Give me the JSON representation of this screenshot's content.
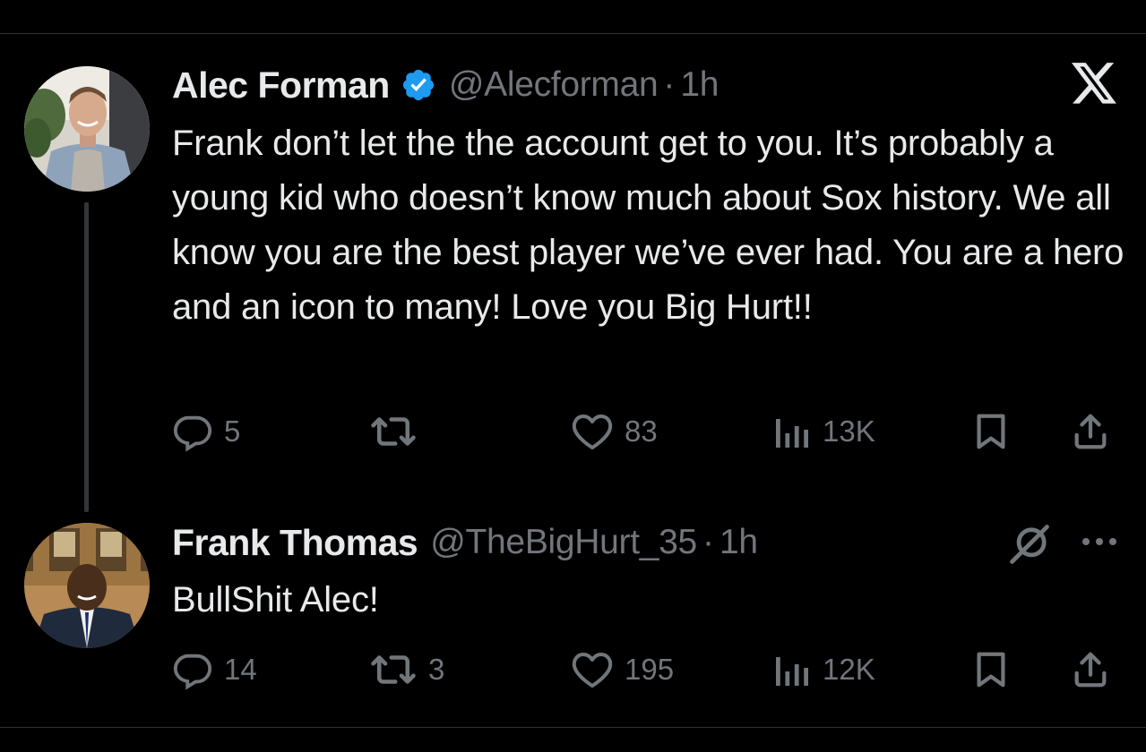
{
  "tweets": [
    {
      "name": "Alec Forman",
      "verified": true,
      "handle": "@Alecforman",
      "dot": "·",
      "time": "1h",
      "text": "Frank don’t let the the account get to you. It’s probably a young kid who doesn’t know much about Sox history. We all know you are the best player we’ve ever had. You are a hero and an icon to many! Love you Big Hurt!!",
      "stats": {
        "replies": "5",
        "retweets": "",
        "likes": "83",
        "views": "13K"
      }
    },
    {
      "name": "Frank Thomas",
      "verified": false,
      "handle": "@TheBigHurt_35",
      "dot": "·",
      "time": "1h",
      "text": "BullShit Alec!",
      "stats": {
        "replies": "14",
        "retweets": "3",
        "likes": "195",
        "views": "12K"
      }
    }
  ],
  "icons": {
    "brand": "x-logo-icon",
    "verified_badge": "verified-badge-icon",
    "reply": "reply-icon",
    "retweet": "retweet-icon",
    "like": "heart-icon",
    "views": "views-icon",
    "bookmark": "bookmark-icon",
    "share": "share-icon",
    "mute": "mute-icon",
    "more": "more-icon"
  },
  "colors": {
    "background": "#000000",
    "text_primary": "#e7e9ea",
    "text_secondary": "#71767b",
    "verified_blue": "#1d9bf0",
    "divider": "#2f3336"
  }
}
